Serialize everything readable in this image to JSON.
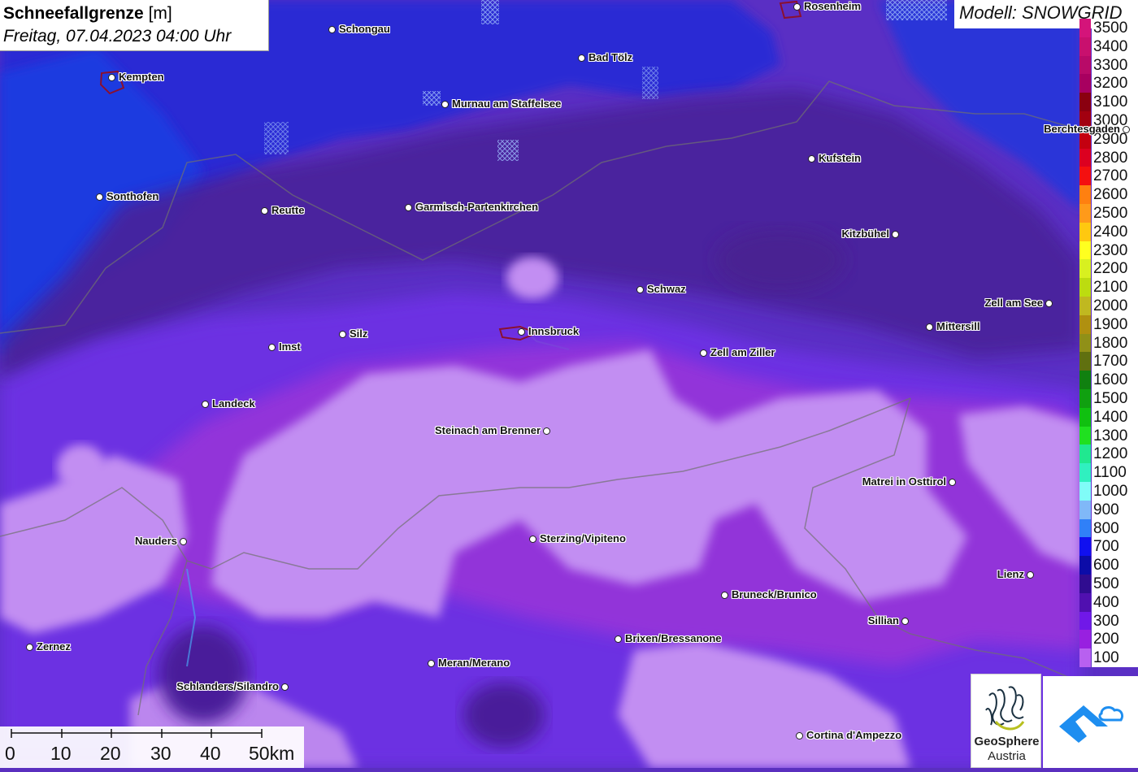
{
  "title": {
    "parameter": "Schneefallgrenze",
    "unit": "[m]",
    "datetime": "Freitag, 07.04.2023 04:00 Uhr"
  },
  "model": "Modell: SNOWGRID",
  "legend": [
    {
      "label": "3500",
      "color": "#d4147a"
    },
    {
      "label": "3400",
      "color": "#c8106e"
    },
    {
      "label": "3300",
      "color": "#b80a68"
    },
    {
      "label": "3200",
      "color": "#a80060"
    },
    {
      "label": "3100",
      "color": "#8a0010"
    },
    {
      "label": "3000",
      "color": "#a20010"
    },
    {
      "label": "2900",
      "color": "#c40010"
    },
    {
      "label": "2800",
      "color": "#dc0020"
    },
    {
      "label": "2700",
      "color": "#f41010"
    },
    {
      "label": "2600",
      "color": "#ff8010"
    },
    {
      "label": "2500",
      "color": "#ff9a1a"
    },
    {
      "label": "2400",
      "color": "#ffc810"
    },
    {
      "label": "2300",
      "color": "#ffff20"
    },
    {
      "label": "2200",
      "color": "#d8f020"
    },
    {
      "label": "2100",
      "color": "#bcdc10"
    },
    {
      "label": "2000",
      "color": "#c0b820"
    },
    {
      "label": "1900",
      "color": "#b09010"
    },
    {
      "label": "1800",
      "color": "#909018"
    },
    {
      "label": "1700",
      "color": "#607010"
    },
    {
      "label": "1600",
      "color": "#108010"
    },
    {
      "label": "1500",
      "color": "#10a010"
    },
    {
      "label": "1400",
      "color": "#10c010"
    },
    {
      "label": "1300",
      "color": "#20e020"
    },
    {
      "label": "1200",
      "color": "#20e890"
    },
    {
      "label": "1100",
      "color": "#30f0c0"
    },
    {
      "label": "1000",
      "color": "#80fcf8"
    },
    {
      "label": "900",
      "color": "#80b8f8"
    },
    {
      "label": "800",
      "color": "#3080f8"
    },
    {
      "label": "700",
      "color": "#1010f0"
    },
    {
      "label": "600",
      "color": "#0c0ca8"
    },
    {
      "label": "500",
      "color": "#300c90"
    },
    {
      "label": "400",
      "color": "#5010b0"
    },
    {
      "label": "300",
      "color": "#7018e8"
    },
    {
      "label": "200",
      "color": "#9820e0"
    },
    {
      "label": "100",
      "color": "#b860f0"
    }
  ],
  "cities": [
    {
      "name": "Rosenheim",
      "side": "right"
    },
    {
      "name": "Schongau",
      "side": "right"
    },
    {
      "name": "Bad Tölz",
      "side": "right"
    },
    {
      "name": "Kempten",
      "side": "right"
    },
    {
      "name": "Murnau am Staffelsee",
      "side": "right"
    },
    {
      "name": "Berchtesgaden",
      "side": "left"
    },
    {
      "name": "Kufstein",
      "side": "right"
    },
    {
      "name": "Sonthofen",
      "side": "right"
    },
    {
      "name": "Reutte",
      "side": "right"
    },
    {
      "name": "Garmisch-Partenkirchen",
      "side": "right"
    },
    {
      "name": "Kitzbühel",
      "side": "left"
    },
    {
      "name": "Schwaz",
      "side": "right"
    },
    {
      "name": "Zell am See",
      "side": "left"
    },
    {
      "name": "Mittersill",
      "side": "right"
    },
    {
      "name": "Innsbruck",
      "side": "right"
    },
    {
      "name": "Silz",
      "side": "right"
    },
    {
      "name": "Imst",
      "side": "right"
    },
    {
      "name": "Zell am Ziller",
      "side": "right"
    },
    {
      "name": "Landeck",
      "side": "right"
    },
    {
      "name": "Steinach am Brenner",
      "side": "left"
    },
    {
      "name": "Matrei in Osttirol",
      "side": "left"
    },
    {
      "name": "Nauders",
      "side": "left"
    },
    {
      "name": "Sterzing/Vipiteno",
      "side": "right"
    },
    {
      "name": "Lienz",
      "side": "left"
    },
    {
      "name": "Bruneck/Brunico",
      "side": "right"
    },
    {
      "name": "Sillian",
      "side": "left"
    },
    {
      "name": "Brixen/Bressanone",
      "side": "right"
    },
    {
      "name": "Zernez",
      "side": "right"
    },
    {
      "name": "Meran/Merano",
      "side": "right"
    },
    {
      "name": "Schlanders/Silandro",
      "side": "left"
    },
    {
      "name": "Cortina d'Ampezzo",
      "side": "right"
    }
  ],
  "scale": {
    "ticks": [
      "0",
      "10",
      "20",
      "30",
      "40",
      "50km"
    ]
  },
  "logos": {
    "geosphere_line1": "GeoSphere",
    "geosphere_line2": "Austria"
  },
  "colors": {
    "deep_blue": "#2a2ad8",
    "dark_purple": "#4a1f9a",
    "mid_purple": "#6a2fe0",
    "magenta": "#9a30d8",
    "light_lilac": "#c490f4",
    "accent_blue": "#1e8ef0"
  }
}
